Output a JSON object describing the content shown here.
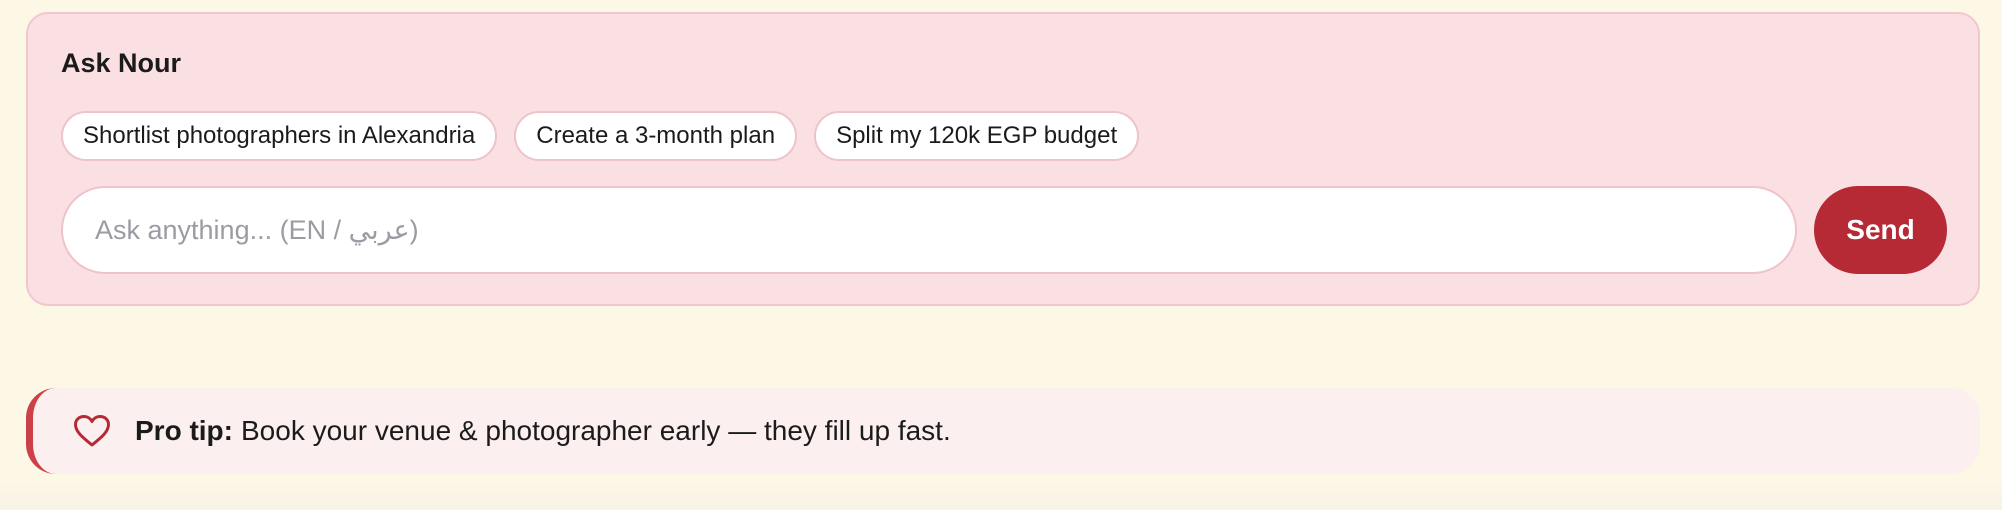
{
  "ask_panel": {
    "title": "Ask Nour",
    "chips": [
      {
        "label": "Shortlist photographers in Alexandria"
      },
      {
        "label": "Create a 3-month plan"
      },
      {
        "label": "Split my 120k EGP budget"
      }
    ],
    "input": {
      "placeholder": "Ask anything... (EN / عربي)",
      "value": ""
    },
    "send_label": "Send"
  },
  "tip": {
    "icon": "heart-icon",
    "label": "Pro tip:",
    "text": "Book your venue & photographer early — they fill up fast."
  },
  "colors": {
    "page_bg": "#fdf7e6",
    "panel_bg": "#fae0e3",
    "panel_border": "#f1c6cd",
    "accent": "#b52a35",
    "tip_bg": "#fcefef",
    "tip_border": "#cc4149"
  }
}
